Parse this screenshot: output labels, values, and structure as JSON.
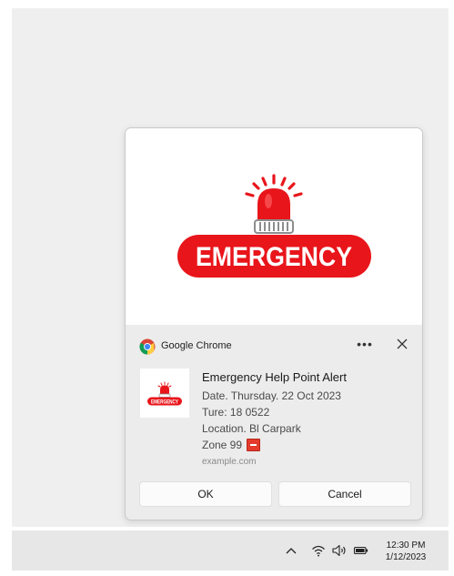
{
  "hero": {
    "banner_text": "EMERGENCY",
    "colors": {
      "red": "#e8151b",
      "grill": "#9a9a9a"
    }
  },
  "header": {
    "app_name": "Google Chrome",
    "more_label": "•••",
    "icons": {
      "app": "chrome-logo-icon",
      "close": "close-icon"
    }
  },
  "notification": {
    "thumbnail_text": "EMERGENCY",
    "title": "Emergency Help Point Alert",
    "lines": [
      "Date. Thursday. 22 Oct 2023",
      "Ture: 18 0522",
      "Location. Bl Carpark"
    ],
    "zone": "Zone 99",
    "zone_icon": "red-flag-icon",
    "domain": "example.com"
  },
  "actions": {
    "ok": "OK",
    "cancel": "Cancel"
  },
  "taskbar": {
    "icons": [
      "chevron-up-icon",
      "wifi-icon",
      "volume-icon",
      "battery-icon"
    ],
    "time": "12:30 PM",
    "date": "1/12/2023"
  }
}
